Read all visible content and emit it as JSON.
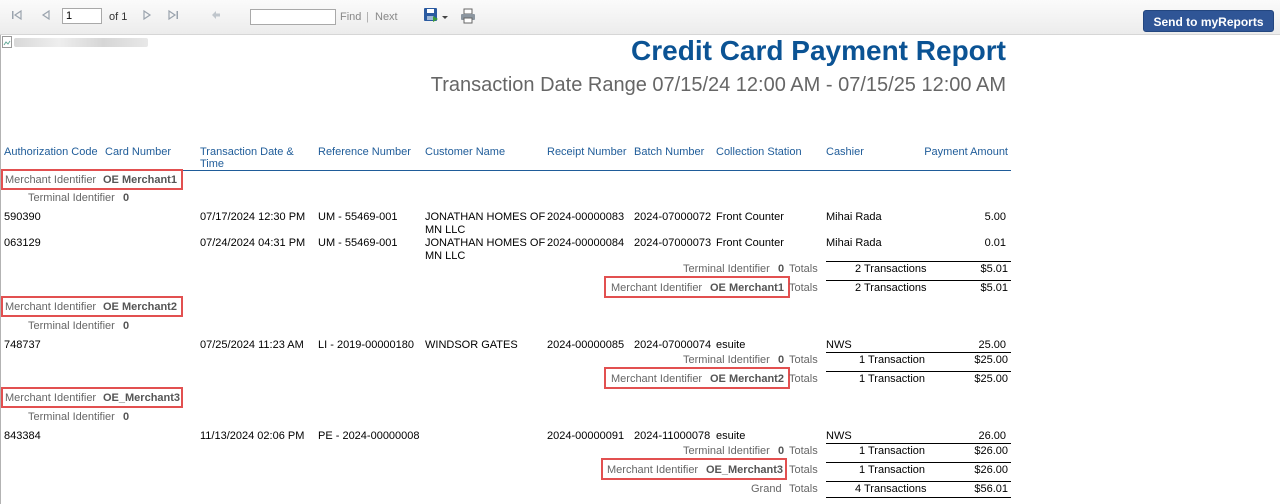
{
  "toolbar": {
    "page_value": "1",
    "page_of": "of 1",
    "find_label": "Find",
    "separator": "|",
    "next_label": "Next",
    "send_label": "Send to myReports",
    "icons": [
      "first-page-icon",
      "prev-page-icon",
      "next-page-icon",
      "last-page-icon",
      "back-icon",
      "export-icon",
      "dropdown-icon",
      "print-icon"
    ]
  },
  "report": {
    "title": "Credit Card Payment Report",
    "subtitle": "Transaction Date Range 07/15/24 12:00 AM - 07/15/25 12:00 AM",
    "columns": [
      "Authorization Code",
      "Card Number",
      "Transaction Date & Time",
      "Reference Number",
      "Customer Name",
      "Receipt Number",
      "Batch Number",
      "Collection Station",
      "Cashier",
      "Payment Amount"
    ],
    "col_txn_date_1": "Transaction Date &",
    "col_txn_date_2": "Time",
    "merchant_label": "Merchant Identifier",
    "terminal_label": "Terminal Identifier",
    "totals_label": "Totals",
    "grand_label": "Grand",
    "groups": [
      {
        "merchant": "OE Merchant1",
        "terminal": "0",
        "rows": [
          {
            "auth": "590390",
            "date": "07/17/2024 12:30 PM",
            "ref": "UM - 55469-001",
            "cust1": "JONATHAN HOMES OF",
            "cust2": "MN LLC",
            "receipt": "2024-00000083",
            "batch": "2024-07000072",
            "station": "Front Counter",
            "cashier": "Mihai Rada",
            "amount": "5.00"
          },
          {
            "auth": "063129",
            "date": "07/24/2024 04:31 PM",
            "ref": "UM - 55469-001",
            "cust1": "JONATHAN HOMES OF",
            "cust2": "MN LLC",
            "receipt": "2024-00000084",
            "batch": "2024-07000073",
            "station": "Front Counter",
            "cashier": "Mihai Rada",
            "amount": "0.01"
          }
        ],
        "terminal_total_count": "2 Transactions",
        "terminal_total_amount": "$5.01",
        "merchant_total_count": "2 Transactions",
        "merchant_total_amount": "$5.01"
      },
      {
        "merchant": "OE Merchant2",
        "terminal": "0",
        "rows": [
          {
            "auth": "748737",
            "date": "07/25/2024 11:23 AM",
            "ref": "LI - 2019-00000180",
            "cust1": "WINDSOR GATES",
            "receipt": "2024-00000085",
            "batch": "2024-07000074",
            "station": "esuite",
            "cashier": "NWS",
            "amount": "25.00"
          }
        ],
        "terminal_total_count": "1 Transaction",
        "terminal_total_amount": "$25.00",
        "merchant_total_count": "1 Transaction",
        "merchant_total_amount": "$25.00"
      },
      {
        "merchant": "OE_Merchant3",
        "terminal": "0",
        "rows": [
          {
            "auth": "843384",
            "date": "11/13/2024 02:06 PM",
            "ref": "PE - 2024-00000008",
            "receipt": "2024-00000091",
            "batch": "2024-11000078",
            "station": "esuite",
            "cashier": "NWS",
            "amount": "26.00"
          }
        ],
        "terminal_total_count": "1 Transaction",
        "terminal_total_amount": "$26.00",
        "merchant_total_count": "1 Transaction",
        "merchant_total_amount": "$26.00"
      }
    ],
    "grand_total_count": "4 Transactions",
    "grand_total_amount": "$56.01"
  }
}
